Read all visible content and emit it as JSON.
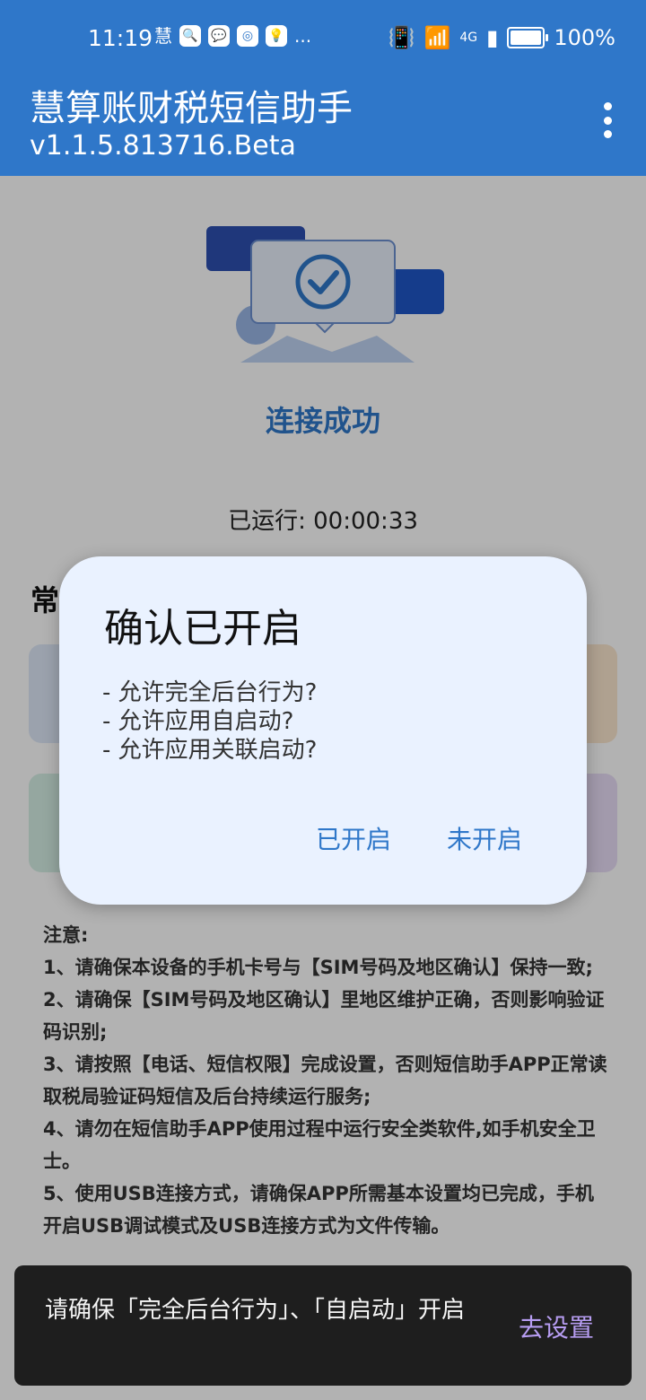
{
  "status_bar": {
    "time": "11:19",
    "left_icons": [
      "慧",
      "search-app-icon",
      "chat-app-icon",
      "browser-app-icon",
      "bulb-app-icon",
      "..."
    ],
    "network": "4G",
    "battery": "100%"
  },
  "app_bar": {
    "title": "慧算账财税短信助手",
    "version": "v1.1.5.813716.Beta"
  },
  "main": {
    "connection_status": "连接成功",
    "running_label": "已运行:",
    "running_time": "00:00:33",
    "section_title_partial": "常",
    "notes": [
      "注意:",
      "1、请确保本设备的手机卡号与【SIM号码及地区确认】保持一致;",
      "2、请确保【SIM号码及地区确认】里地区维护正确，否则影响验证码识别;",
      "3、请按照【电话、短信权限】完成设置，否则短信助手APP正常读取税局验证码短信及后台持续运行服务;",
      "4、请勿在短信助手APP使用过程中运行安全类软件,如手机安全卫士。",
      "5、使用USB连接方式，请确保APP所需基本设置均已完成，手机开启USB调试模式及USB连接方式为文件传输。"
    ]
  },
  "dialog": {
    "title": "确认已开启",
    "lines": [
      "- 允许完全后台行为?",
      "- 允许应用自启动?",
      "- 允许应用关联启动?"
    ],
    "confirm_label": "已开启",
    "deny_label": "未开启"
  },
  "snackbar": {
    "message": "请确保「完全后台行为」、「自启动」开启",
    "action_label": "去设置"
  },
  "colors": {
    "primary": "#2f77c9",
    "dialog_bg": "#eaf2ff",
    "snackbar_bg": "#1e1e1e",
    "snackbar_action": "#b79df2"
  }
}
